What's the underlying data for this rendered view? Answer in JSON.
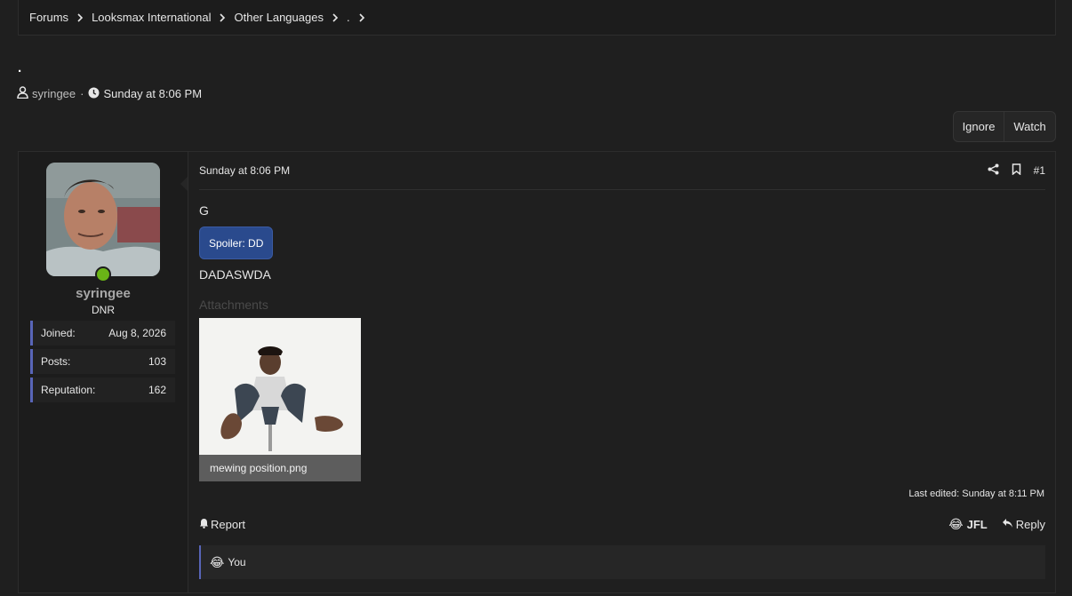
{
  "breadcrumb": [
    "Forums",
    "Looksmax International",
    "Other Languages",
    "."
  ],
  "thread": {
    "title": ".",
    "author": "syringee",
    "separator": "·",
    "date": "Sunday at 8:06 PM",
    "ignore_label": "Ignore",
    "watch_label": "Watch"
  },
  "user": {
    "name": "syringee",
    "title": "DNR",
    "stats": [
      {
        "label": "Joined:",
        "value": "Aug 8, 2026"
      },
      {
        "label": "Posts:",
        "value": "103"
      },
      {
        "label": "Reputation:",
        "value": "162"
      }
    ]
  },
  "post": {
    "date": "Sunday at 8:06 PM",
    "number": "#1",
    "line1": "G",
    "spoiler_label": "Spoiler: DD",
    "line2": "DADASWDA",
    "attachments_label": "Attachments",
    "attachment_caption": "mewing position.png",
    "last_edited": "Last edited: Sunday at 8:11 PM",
    "report_label": "Report",
    "jfl_label": "JFL",
    "reply_label": "Reply",
    "reaction_emoji": "😂",
    "reactions_text": "You"
  },
  "colors": {
    "background": "#1f1f1f",
    "accent": "#5865b8",
    "spoiler": "#2a4a8d",
    "online": "#6ab417"
  }
}
